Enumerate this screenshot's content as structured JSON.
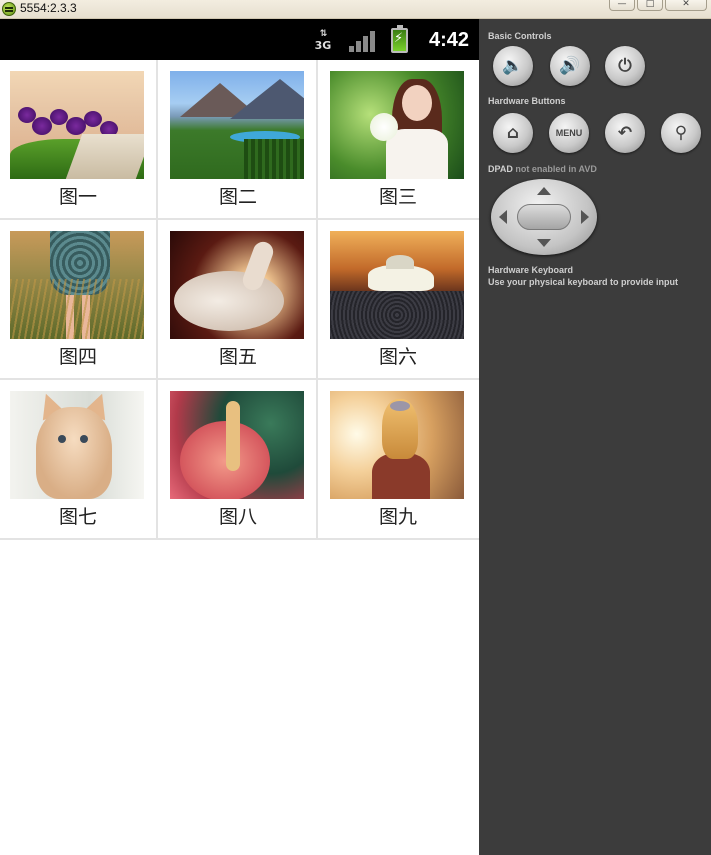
{
  "window": {
    "title": "5554:2.3.3",
    "controls": {
      "minimize": "—",
      "maximize": "□",
      "close": "✕"
    }
  },
  "statusbar": {
    "network_type": "3G",
    "time": "4:42",
    "icons": [
      "data-3g-icon",
      "signal-strength-icon",
      "battery-charging-icon"
    ]
  },
  "gallery": {
    "items": [
      {
        "caption": "图一",
        "subject": "purple-flowers"
      },
      {
        "caption": "图二",
        "subject": "mountain-landscape"
      },
      {
        "caption": "图三",
        "subject": "girl-with-bouquet"
      },
      {
        "caption": "图四",
        "subject": "girl-in-grass"
      },
      {
        "caption": "图五",
        "subject": "white-cat"
      },
      {
        "caption": "图六",
        "subject": "white-car"
      },
      {
        "caption": "图七",
        "subject": "kitten"
      },
      {
        "caption": "图八",
        "subject": "flower-closeup"
      },
      {
        "caption": "图九",
        "subject": "girl-with-bow"
      }
    ]
  },
  "panel": {
    "basic_controls_title": "Basic Controls",
    "basic_controls": [
      "volume-down-icon",
      "volume-up-icon",
      "power-icon"
    ],
    "hardware_buttons_title": "Hardware Buttons",
    "hardware_buttons": [
      {
        "icon": "home-icon",
        "label": ""
      },
      {
        "icon": "menu-button",
        "label": "MENU"
      },
      {
        "icon": "back-icon",
        "label": ""
      },
      {
        "icon": "search-icon",
        "label": ""
      }
    ],
    "dpad_title": "DPAD",
    "dpad_note": "not enabled in AVD",
    "keyboard_title": "Hardware Keyboard",
    "keyboard_subtitle": "Use your physical keyboard to provide input"
  },
  "colors": {
    "panel_bg": "#3c3c3c",
    "statusbar_bg": "#000000",
    "screen_bg": "#ffffff"
  }
}
